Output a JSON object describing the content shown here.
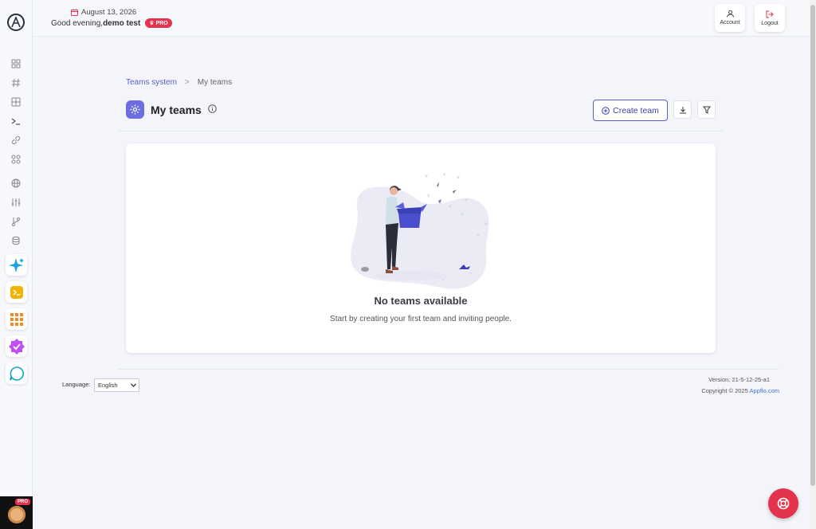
{
  "header": {
    "date": "August 13, 2026",
    "greeting_prefix": "Good evening,",
    "user_name": "demo test",
    "pro_badge": "PRO",
    "account_label": "Account",
    "logout_label": "Logout"
  },
  "sidebar": {
    "items": [
      {
        "icon": "dashboard-icon"
      },
      {
        "icon": "hash-icon"
      },
      {
        "icon": "grid-icon"
      },
      {
        "icon": "terminal-icon"
      },
      {
        "icon": "link-icon"
      },
      {
        "icon": "integration-icon"
      },
      {
        "icon": "globe-icon"
      },
      {
        "icon": "sliders-icon"
      },
      {
        "icon": "branch-icon"
      },
      {
        "icon": "database-icon"
      }
    ],
    "apps": [
      {
        "icon": "sparkle-app-icon"
      },
      {
        "icon": "console-app-icon"
      },
      {
        "icon": "apps-grid-icon"
      },
      {
        "icon": "check-badge-app-icon"
      },
      {
        "icon": "chat-app-icon"
      }
    ],
    "avatar_pro": "PRO"
  },
  "breadcrumb": {
    "parent": "Teams system",
    "separator": ">",
    "current": "My teams"
  },
  "page": {
    "title": "My teams",
    "create_button": "Create team"
  },
  "empty_state": {
    "title": "No teams available",
    "subtitle": "Start by creating your first team and inviting people."
  },
  "footer": {
    "language_label": "Language:",
    "language_value": "English",
    "version": "Version: 21-5-12-25-a1",
    "copyright_prefix": "Copyright © 2025 ",
    "copyright_brand": "Appflo.com"
  },
  "colors": {
    "accent": "#5a5fc7",
    "pro": "#e3334e",
    "fab": "#e3334e"
  }
}
